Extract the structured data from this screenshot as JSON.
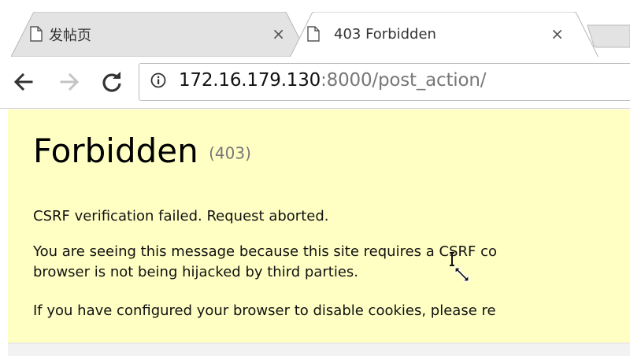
{
  "tabs": [
    {
      "title": "发帖页",
      "close": "×",
      "active": false
    },
    {
      "title": "403 Forbidden",
      "close": "×",
      "active": true
    }
  ],
  "toolbar": {
    "url_host": "172.16.179.130",
    "url_rest": ":8000/post_action/"
  },
  "page": {
    "heading": "Forbidden",
    "status_code": "(403)",
    "line1": "CSRF verification failed. Request aborted.",
    "line2a": "You are seeing this message because this site requires a CSRF co",
    "line2b": "browser is not being hijacked by third parties.",
    "line3": "If you have configured your browser to disable cookies, please re"
  },
  "colors": {
    "page_bg": "#ffffc4",
    "tab_inactive": "#e3e3e3",
    "tab_active": "#ffffff"
  }
}
